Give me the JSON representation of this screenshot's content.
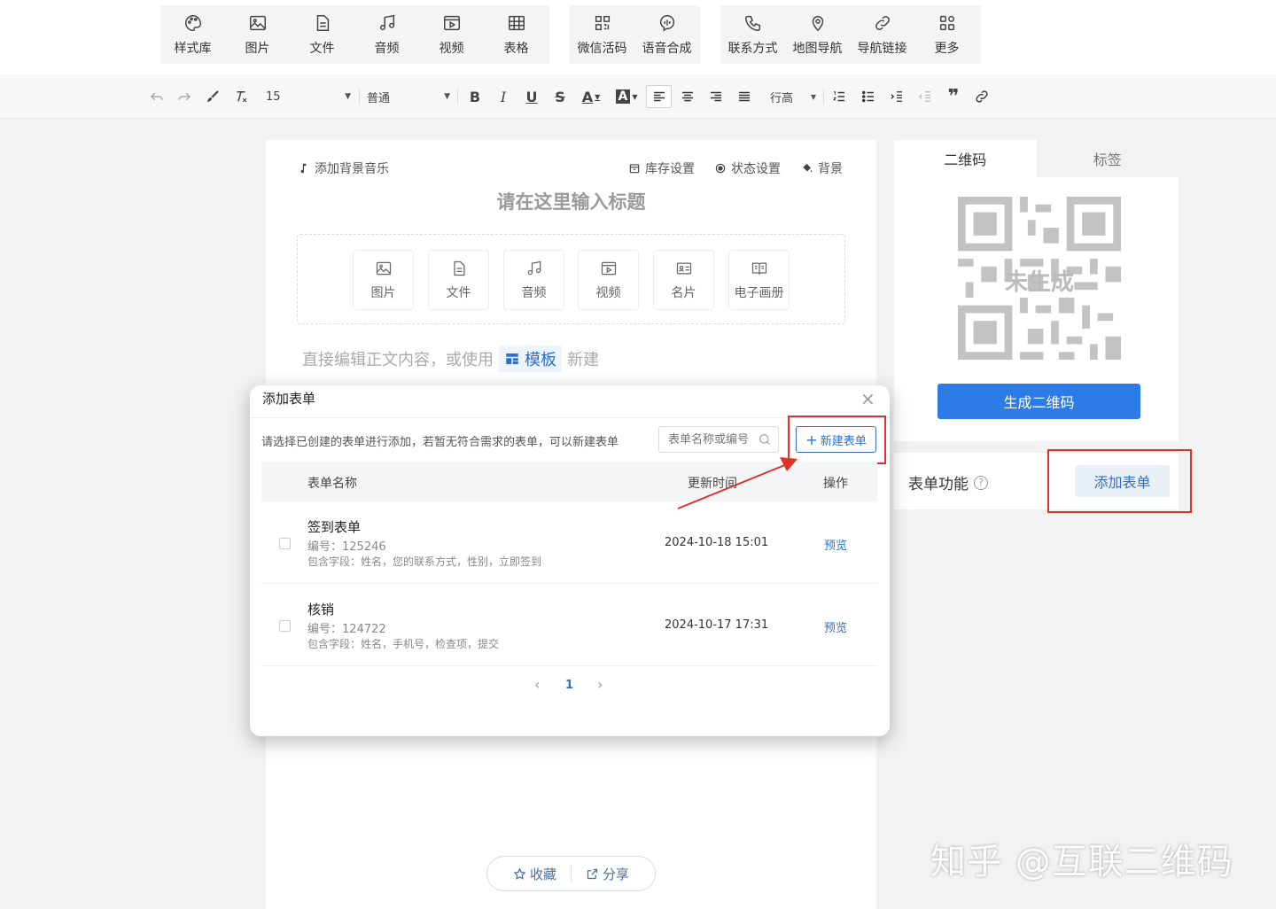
{
  "insert_toolbar": {
    "group1": [
      {
        "label": "样式库",
        "icon": "palette-icon"
      },
      {
        "label": "图片",
        "icon": "image-icon"
      },
      {
        "label": "文件",
        "icon": "file-icon"
      },
      {
        "label": "音频",
        "icon": "music-icon"
      },
      {
        "label": "视频",
        "icon": "video-icon"
      },
      {
        "label": "表格",
        "icon": "table-icon"
      }
    ],
    "group2": [
      {
        "label": "微信活码",
        "icon": "qr-code-icon"
      },
      {
        "label": "语音合成",
        "icon": "voice-icon"
      }
    ],
    "group3": [
      {
        "label": "联系方式",
        "icon": "phone-icon"
      },
      {
        "label": "地图导航",
        "icon": "map-pin-icon"
      },
      {
        "label": "导航链接",
        "icon": "link-icon"
      },
      {
        "label": "更多",
        "icon": "more-grid-icon"
      }
    ]
  },
  "format_bar": {
    "font_size": "15",
    "paragraph_style": "普通",
    "line_height": "行高",
    "bold": "B",
    "italic": "I",
    "underline": "U",
    "strike": "S",
    "font_color": "A",
    "bg_color": "A",
    "quote": "❞"
  },
  "editor": {
    "bg_music": "添加背景音乐",
    "stock_settings": "库存设置",
    "status_settings": "状态设置",
    "background": "背景",
    "title_placeholder": "请在这里输入标题",
    "media": [
      "图片",
      "文件",
      "音频",
      "视频",
      "名片",
      "电子画册"
    ],
    "hint_prefix": "直接编辑正文内容，或使用",
    "template": "模板",
    "hint_suffix": "新建",
    "favorite": "收藏",
    "share": "分享"
  },
  "right_panel": {
    "tabs": [
      "二维码",
      "标签"
    ],
    "qr_status": "未生成",
    "generate_button": "生成二维码",
    "form_feature_label": "表单功能",
    "help": "?",
    "add_form_button": "添加表单"
  },
  "modal": {
    "title": "添加表单",
    "close": "×",
    "description": "请选择已创建的表单进行添加，若暂无符合需求的表单，可以新建表单",
    "search_placeholder": "表单名称或编号",
    "new_button": "新建表单",
    "columns": {
      "name": "表单名称",
      "updated": "更新时间",
      "action": "操作"
    },
    "rows": [
      {
        "name": "签到表单",
        "number": "编号：125246",
        "fields": "包含字段：姓名，您的联系方式，性别，立即签到",
        "updated": "2024-10-18 15:01",
        "action": "预览"
      },
      {
        "name": "核销",
        "number": "编号：124722",
        "fields": "包含字段：姓名，手机号，检查项，提交",
        "updated": "2024-10-17 17:31",
        "action": "预览"
      }
    ],
    "pager": {
      "prev": "‹",
      "current": "1",
      "next": "›"
    }
  },
  "watermark": "知乎 @互联二维码",
  "colors": {
    "accent": "#2d7be5",
    "highlight": "#e0302a",
    "link": "#2f6fc9"
  }
}
